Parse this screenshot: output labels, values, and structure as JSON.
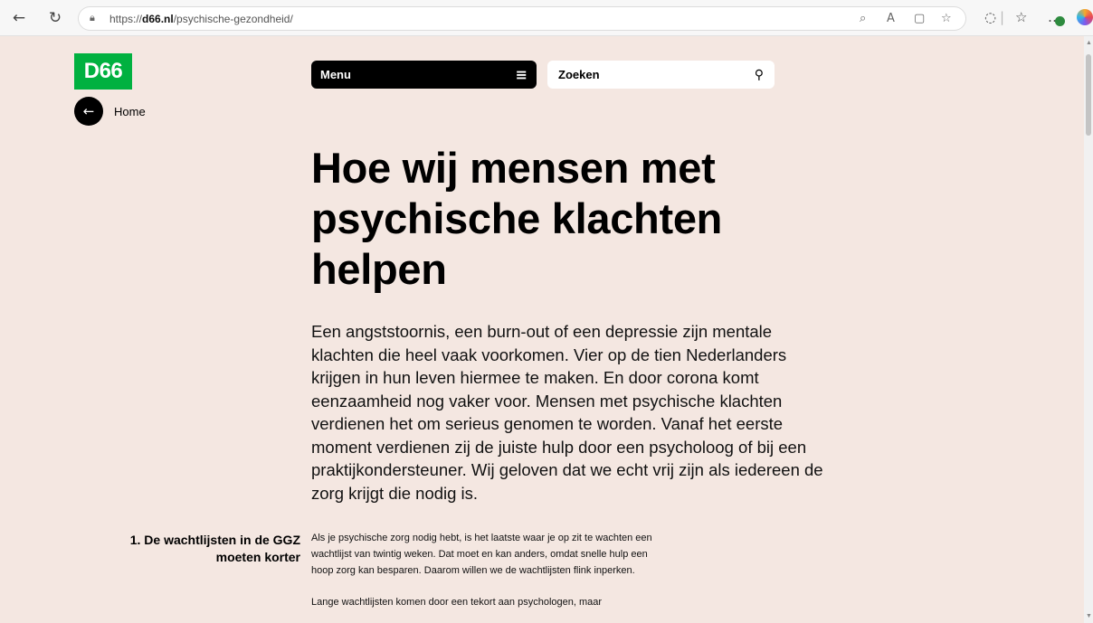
{
  "browser": {
    "url_prefix": "https://",
    "url_domain": "d66.nl",
    "url_path": "/psychische-gezondheid/",
    "icons": [
      "back-arrow-icon",
      "refresh-icon",
      "lock-icon",
      "zoom-icon",
      "read-aloud-icon",
      "immersive-reader-icon",
      "favorite-star-icon",
      "copilot-icon",
      "favorites-icon",
      "more-icon"
    ]
  },
  "header": {
    "logo": "D66",
    "home_label": "Home",
    "menu_label": "Menu",
    "search_placeholder": "Zoeken"
  },
  "main": {
    "title": "Hoe wij mensen met psychische klachten helpen",
    "intro": "Een angststoornis, een burn-out of een depressie zijn mentale klachten die heel vaak voorkomen. Vier op de tien Nederlanders krijgen in hun leven hiermee te maken. En door corona komt eenzaamheid nog vaker voor. Mensen met psychische klachten verdienen het om serieus genomen te worden. Vanaf het eerste moment verdienen zij de juiste hulp door een psycholoog of bij een praktijkondersteuner. Wij geloven dat we echt vrij zijn als iedereen de zorg krijgt die nodig is."
  },
  "section1": {
    "heading": "1. De wachtlijsten in de GGZ moeten korter",
    "paragraph1": "Als je psychische zorg nodig hebt, is het laatste waar je op zit te wachten een wachtlijst van twintig weken. Dat moet en kan anders, omdat snelle hulp een hoop zorg kan besparen. Daarom willen we de wachtlijsten flink inperken.",
    "paragraph2": "Lange wachtlijsten komen door een tekort aan psychologen, maar"
  },
  "colors": {
    "page_background": "#f4e7e1",
    "logo_green": "#00b140",
    "text": "#000000"
  }
}
